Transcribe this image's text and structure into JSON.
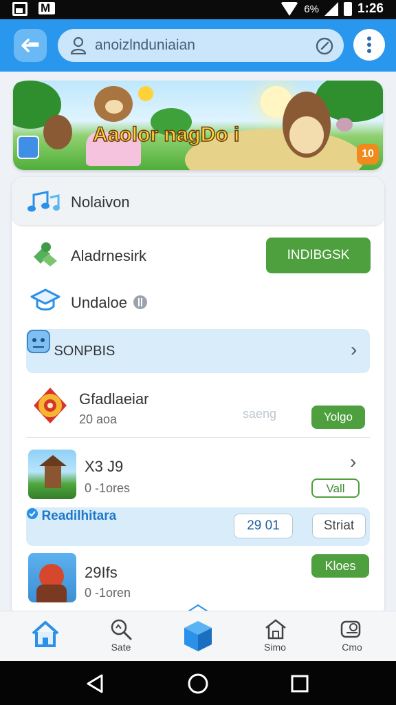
{
  "status_bar": {
    "battery_pct": "6%",
    "time": "1:26"
  },
  "search": {
    "query": "anoizlnduniaian"
  },
  "banner": {
    "title": "Aaolor nagDo i",
    "badge": "10"
  },
  "rows": {
    "nav_header": {
      "label": "Nolaivon"
    },
    "addressing": {
      "label": "Aladrnesirk",
      "button": "INDIBGSK"
    },
    "update": {
      "label": "Undaloe"
    },
    "sonpbis": {
      "label": "SONPBIS"
    },
    "gradlaeiar": {
      "label": "Gfadlaeiar",
      "sub": "20 aoa",
      "value": "saeng",
      "button": "Yolgo"
    },
    "app1": {
      "title": "X3 J9",
      "sub": "0 -1ores",
      "button": "Vall"
    },
    "readhitera": {
      "label": "Readilhitara",
      "count": "29 01",
      "button": "Striat"
    },
    "app2": {
      "title": "29Ifs",
      "sub": "0 -1oren",
      "button": "Kloes"
    }
  },
  "bottom_nav": {
    "items": [
      {
        "label": ""
      },
      {
        "label": "Sate"
      },
      {
        "label": ""
      },
      {
        "label": "Simo"
      },
      {
        "label": "Cmo"
      }
    ]
  },
  "colors": {
    "accent": "#2a97ee",
    "green": "#4e9f3d",
    "highlight": "#d8ecfa"
  }
}
